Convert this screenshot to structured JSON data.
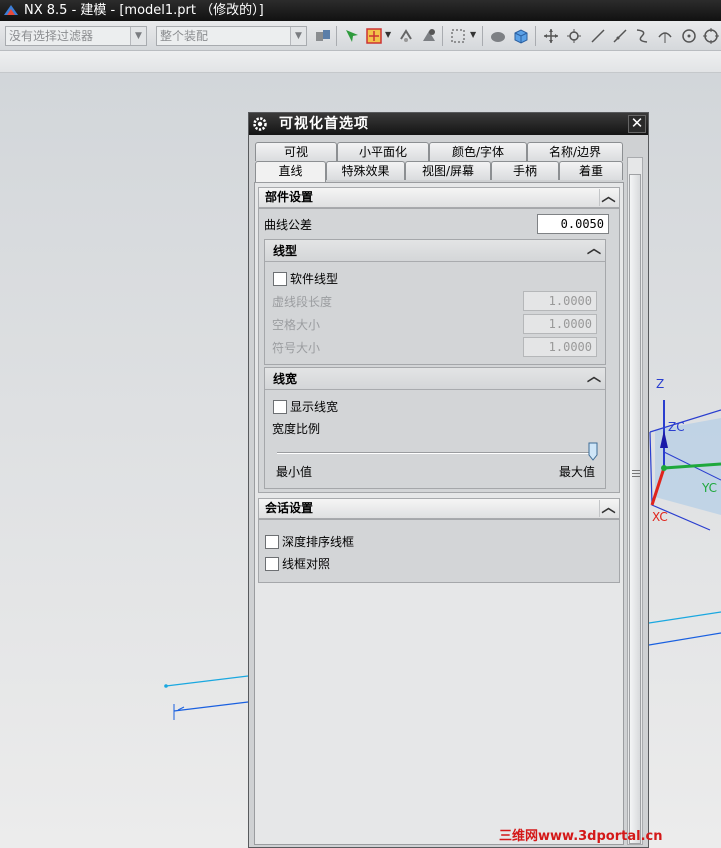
{
  "window": {
    "title": "NX 8.5 - 建模 - [model1.prt （修改的）]"
  },
  "toolbar": {
    "filter_combo": "没有选择过滤器",
    "assembly_combo": "整个装配",
    "icons": [
      "snap-icon",
      "select-icon",
      "point-icon",
      "move-icon",
      "box-select-icon",
      "solid-icon",
      "cube-icon",
      "move-view-icon",
      "rotate-icon",
      "line-icon",
      "arc-icon",
      "curve-icon",
      "point-on-icon",
      "circle-icon",
      "center-icon"
    ]
  },
  "dialog": {
    "title": "可视化首选项",
    "close_label": "✕",
    "tabs_row1": [
      "可视",
      "小平面化",
      "颜色/字体",
      "名称/边界"
    ],
    "tabs_row2": [
      "直线",
      "特殊效果",
      "视图/屏幕",
      "手柄",
      "着重"
    ],
    "active_tab": "直线",
    "part_settings": {
      "header": "部件设置",
      "curve_tolerance_label": "曲线公差",
      "curve_tolerance_value": "0.0050",
      "linetype": {
        "header": "线型",
        "software_linetype_label": "软件线型",
        "software_linetype_checked": false,
        "dash_length_label": "虚线段长度",
        "dash_length_value": "1.0000",
        "space_size_label": "空格大小",
        "space_size_value": "1.0000",
        "symbol_size_label": "符号大小",
        "symbol_size_value": "1.0000"
      },
      "linewidth": {
        "header": "线宽",
        "show_linewidth_label": "显示线宽",
        "show_linewidth_checked": false,
        "width_scale_label": "宽度比例",
        "min_label": "最小值",
        "max_label": "最大值",
        "slider_level": 1.0
      }
    },
    "session_settings": {
      "header": "会话设置",
      "depth_sort_label": "深度排序线框",
      "depth_sort_checked": false,
      "wireframe_contrast_label": "线框对照",
      "wireframe_contrast_checked": false
    }
  },
  "viewport": {
    "axis_labels": {
      "z": "Z",
      "zc": "ZC",
      "yc": "YC",
      "xc": "XC"
    },
    "colors": {
      "x_axis": "#e0241c",
      "y_axis": "#1ea83c",
      "z_axis": "#2a3ecf",
      "curve": "#1aa8e0"
    }
  },
  "watermark": "三维网www.3dportal.cn"
}
